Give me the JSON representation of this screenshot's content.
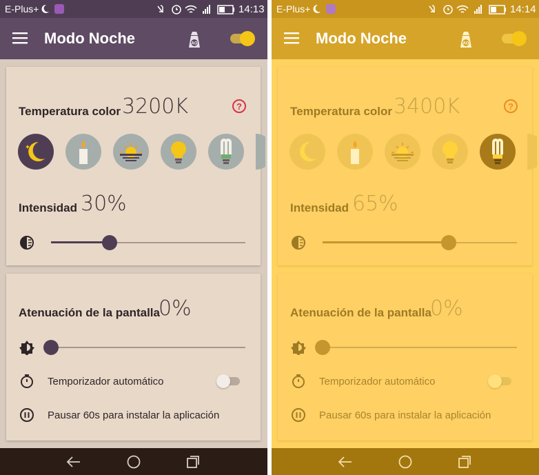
{
  "screens": [
    {
      "status": {
        "carrier": "E-Plus+",
        "time": "14:13"
      },
      "appbar": {
        "title": "Modo Noche"
      },
      "temperature": {
        "label": "Temperatura color",
        "value": "3200K",
        "selected_option": "moon"
      },
      "intensity": {
        "label": "Intensidad",
        "value": "30%",
        "level_percent": 30
      },
      "dimming": {
        "label": "Atenuación de la pantalla",
        "value": "0%",
        "level_percent": 0
      },
      "timer": {
        "label": "Temporizador automático",
        "enabled": false
      },
      "pause": {
        "label": "Pausar 60s para instalar la aplicación"
      }
    },
    {
      "status": {
        "carrier": "E-Plus+",
        "time": "14:14"
      },
      "appbar": {
        "title": "Modo Noche"
      },
      "temperature": {
        "label": "Temperatura color",
        "value": "3400K",
        "selected_option": "cfl-bulb"
      },
      "intensity": {
        "label": "Intensidad",
        "value": "65%",
        "level_percent": 65
      },
      "dimming": {
        "label": "Atenuación de la pantalla",
        "value": "0%",
        "level_percent": 0
      },
      "timer": {
        "label": "Temporizador automático",
        "enabled": false
      },
      "pause": {
        "label": "Pausar 60s para instalar la aplicación"
      }
    }
  ],
  "options": [
    {
      "name": "moon",
      "icon": "moon-icon"
    },
    {
      "name": "candle",
      "icon": "candle-icon"
    },
    {
      "name": "sunset",
      "icon": "sunset-icon"
    },
    {
      "name": "bulb",
      "icon": "lightbulb-icon"
    },
    {
      "name": "cfl-bulb",
      "icon": "cfl-bulb-icon"
    }
  ],
  "colors": {
    "night_primary": "#5f4b63",
    "night_background": "#e8d8c8",
    "warm_primary": "#d6a429",
    "warm_background": "#ffd064",
    "accent_yellow": "#f5c518",
    "help_red": "#d8324a",
    "help_orange": "#f08a1c"
  }
}
